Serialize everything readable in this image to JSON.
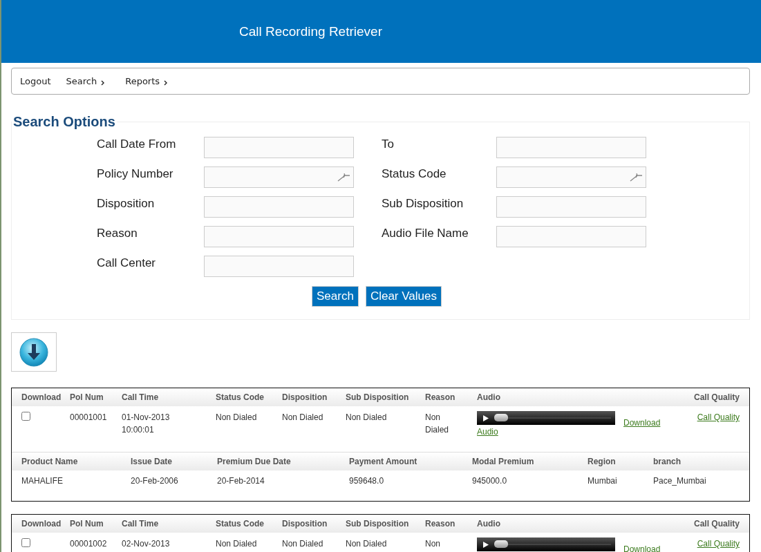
{
  "header": {
    "title": "Call Recording Retriever"
  },
  "nav": [
    {
      "label": "Logout",
      "submenu": false
    },
    {
      "label": "Search",
      "submenu": true
    },
    {
      "label": "Reports",
      "submenu": true
    }
  ],
  "search_options": {
    "title": "Search Options",
    "fields": [
      {
        "label": "Call Date From",
        "lookup": false
      },
      {
        "label": "To",
        "lookup": false
      },
      {
        "label": "Policy Number",
        "lookup": true
      },
      {
        "label": "Status Code",
        "lookup": true
      },
      {
        "label": "Disposition",
        "lookup": false
      },
      {
        "label": "Sub Disposition",
        "lookup": false
      },
      {
        "label": "Reason",
        "lookup": false
      },
      {
        "label": "Audio File Name",
        "lookup": false
      },
      {
        "label": "Call Center",
        "lookup": false
      }
    ],
    "buttons": [
      "Search",
      "Clear Values"
    ]
  },
  "records": [
    {
      "columns": [
        "Download",
        "Pol Num",
        "Call Time",
        "Status Code",
        "Disposition",
        "Sub Disposition",
        "Reason",
        "Audio",
        "Call Quality"
      ],
      "checked": false,
      "pol_num": "00001001",
      "call_time": [
        "01-Nov-2013",
        "10:00:01"
      ],
      "status_code": "Non Dialed",
      "disposition": "Non Dialed",
      "sub_disposition": "Non Dialed",
      "reason": "Non Dialed",
      "audio": {
        "level": 0,
        "audio_link": "Audio",
        "download_link": "Download"
      },
      "call_quality": "Call Quality",
      "detail_columns": [
        "Product Name",
        "Issue Date",
        "Premium Due Date",
        "Payment Amount",
        "Modal Premium",
        "Region",
        "branch"
      ],
      "details": [
        "MAHALIFE",
        "20-Feb-2006",
        "20-Feb-2014",
        "959648.0",
        "945000.0",
        "Mumbai",
        "Pace_Mumbai"
      ]
    },
    {
      "columns": [
        "Download",
        "Pol Num",
        "Call Time",
        "Status Code",
        "Disposition",
        "Sub Disposition",
        "Reason",
        "Audio",
        "Call Quality"
      ],
      "checked": false,
      "pol_num": "00001002",
      "call_time": [
        "02-Nov-2013"
      ],
      "status_code": "Non Dialed",
      "disposition": "Non Dialed",
      "sub_disposition": "Non Dialed",
      "reason": "Non",
      "audio": {
        "level": 0,
        "download_link": "Download"
      },
      "call_quality": "Call Quality"
    }
  ]
}
